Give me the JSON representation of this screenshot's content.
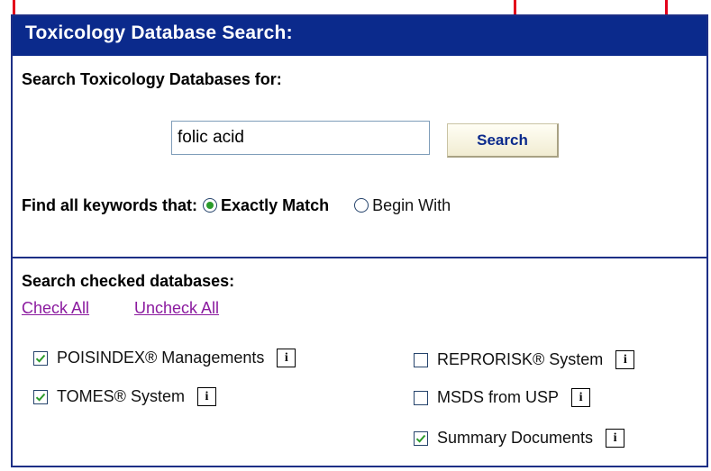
{
  "panel": {
    "title": "Toxicology Database Search:",
    "search_label": "Search Toxicology Databases for:",
    "search_value": "folic acid",
    "search_button": "Search",
    "match_label": "Find all keywords that:",
    "match_options": [
      {
        "label": "Exactly Match",
        "selected": true
      },
      {
        "label": "Begin With",
        "selected": false
      }
    ],
    "databases_label": "Search checked databases:",
    "check_all": "Check All",
    "uncheck_all": "Uncheck All",
    "info_glyph": "i",
    "databases": [
      {
        "label": "POISINDEX® Managements",
        "checked": true
      },
      {
        "label": "TOMES® System",
        "checked": true
      },
      {
        "label": "REPRORISK® System",
        "checked": false
      },
      {
        "label": "MSDS from USP",
        "checked": false
      },
      {
        "label": "Summary Documents",
        "checked": true
      }
    ]
  },
  "colors": {
    "title_bar": "#0b2a8c",
    "border": "#1d2f86",
    "link": "#8b1a9f",
    "check": "#2b9b2b",
    "callout_line": "#e3001b"
  }
}
